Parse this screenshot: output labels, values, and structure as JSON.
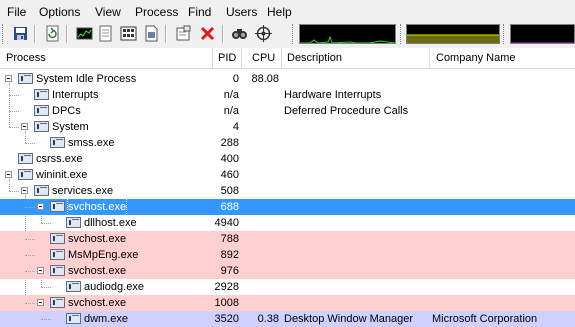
{
  "menu": [
    "File",
    "Options",
    "View",
    "Process",
    "Find",
    "Users",
    "Help"
  ],
  "toolbar": {
    "icons": [
      "save-icon",
      "refresh-icon",
      "system-info-icon",
      "dll-view-icon",
      "handle-view-icon",
      "properties-icon",
      "kill-process-icon",
      "find-icon",
      "target-icon"
    ]
  },
  "columns": {
    "process": "Process",
    "pid": "PID",
    "cpu": "CPU",
    "description": "Description",
    "company": "Company Name"
  },
  "colors": {
    "selected": "#3399ff",
    "service": "#ffd0d0",
    "own_process": "#d0d0ff"
  },
  "rows": [
    {
      "name": "System Idle Process",
      "pid": "0",
      "cpu": "88.08",
      "description": "",
      "company": "",
      "level": 0,
      "expander": true,
      "style": "normal"
    },
    {
      "name": "Interrupts",
      "pid": "n/a",
      "cpu": "",
      "description": "Hardware Interrupts",
      "company": "",
      "level": 1,
      "expander": false,
      "style": "normal"
    },
    {
      "name": "DPCs",
      "pid": "n/a",
      "cpu": "",
      "description": "Deferred Procedure Calls",
      "company": "",
      "level": 1,
      "expander": false,
      "style": "normal"
    },
    {
      "name": "System",
      "pid": "4",
      "cpu": "",
      "description": "",
      "company": "",
      "level": 1,
      "expander": true,
      "style": "normal"
    },
    {
      "name": "smss.exe",
      "pid": "288",
      "cpu": "",
      "description": "",
      "company": "",
      "level": 2,
      "expander": false,
      "style": "normal"
    },
    {
      "name": "csrss.exe",
      "pid": "400",
      "cpu": "",
      "description": "",
      "company": "",
      "level": 0,
      "expander": false,
      "style": "normal"
    },
    {
      "name": "wininit.exe",
      "pid": "460",
      "cpu": "",
      "description": "",
      "company": "",
      "level": 0,
      "expander": true,
      "style": "normal"
    },
    {
      "name": "services.exe",
      "pid": "508",
      "cpu": "",
      "description": "",
      "company": "",
      "level": 1,
      "expander": true,
      "style": "normal"
    },
    {
      "name": "svchost.exe",
      "pid": "688",
      "cpu": "",
      "description": "",
      "company": "",
      "level": 2,
      "expander": true,
      "style": "selected"
    },
    {
      "name": "dllhost.exe",
      "pid": "4940",
      "cpu": "",
      "description": "",
      "company": "",
      "level": 3,
      "expander": false,
      "style": "normal"
    },
    {
      "name": "svchost.exe",
      "pid": "788",
      "cpu": "",
      "description": "",
      "company": "",
      "level": 2,
      "expander": false,
      "style": "service"
    },
    {
      "name": "MsMpEng.exe",
      "pid": "892",
      "cpu": "",
      "description": "",
      "company": "",
      "level": 2,
      "expander": false,
      "style": "service"
    },
    {
      "name": "svchost.exe",
      "pid": "976",
      "cpu": "",
      "description": "",
      "company": "",
      "level": 2,
      "expander": true,
      "style": "service"
    },
    {
      "name": "audiodg.exe",
      "pid": "2928",
      "cpu": "",
      "description": "",
      "company": "",
      "level": 3,
      "expander": false,
      "style": "normal"
    },
    {
      "name": "svchost.exe",
      "pid": "1008",
      "cpu": "",
      "description": "",
      "company": "",
      "level": 2,
      "expander": true,
      "style": "service"
    },
    {
      "name": "dwm.exe",
      "pid": "3520",
      "cpu": "0.38",
      "description": "Desktop Window Manager",
      "company": "Microsoft Corporation",
      "level": 3,
      "expander": false,
      "style": "own_process"
    }
  ]
}
